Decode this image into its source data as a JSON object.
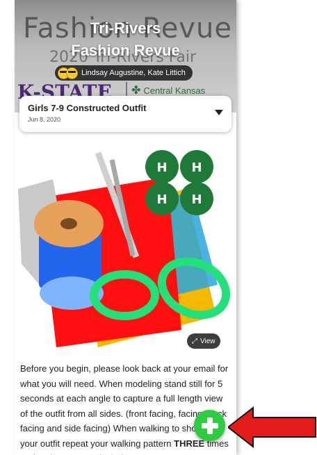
{
  "header": {
    "background_title": "Fashion Revue",
    "background_subtitle": "2020 Tri-Rivers Fair",
    "background_kstate": "K-STATE",
    "background_central": "Central Kansas",
    "title_line1": "Tri-Rivers",
    "title_line2": "Fashion Revue",
    "authors": "Lindsay Augustine, Kate Littich"
  },
  "entry_card": {
    "title": "Girls 7-9 Constructed Outfit",
    "date": "Jun 8, 2020"
  },
  "image": {
    "view_label": "View"
  },
  "body": {
    "text_before": "Before you begin, please look back at your email for what you will need. When modeling stand still for 5 seconds at each angle to capture a full length view of the outfit from all sides. (front facing, facing, back facing and side facing) When walking to show off your outfit repeat your walking pattern ",
    "text_bold": "THREE",
    "text_after": " times and make sure you include"
  },
  "colors": {
    "fab": "#2ecc40",
    "arrow": "#e21b1b",
    "authors_pill": "#191919"
  }
}
